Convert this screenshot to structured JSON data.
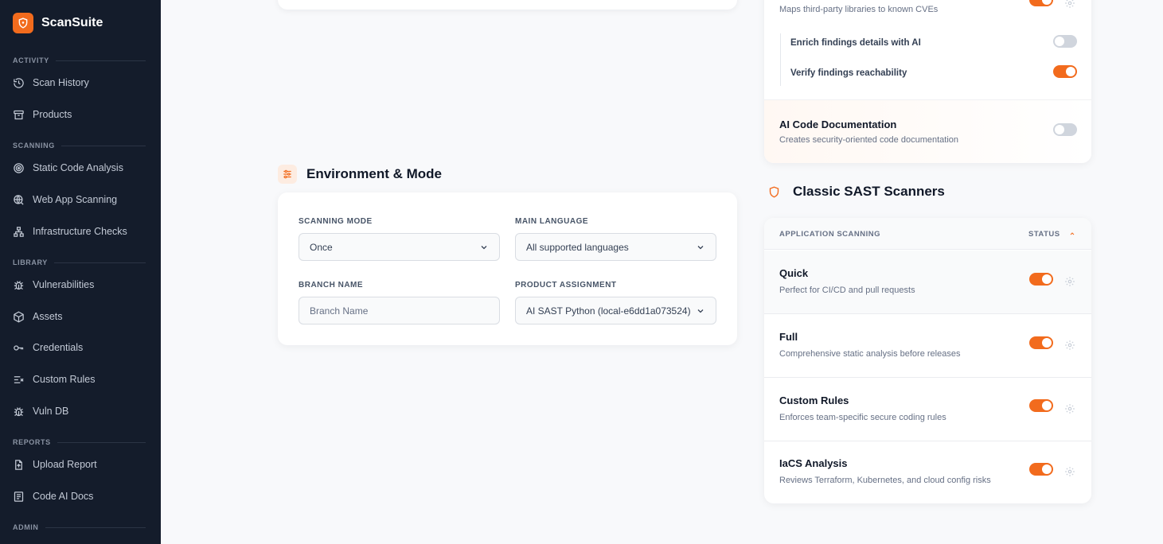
{
  "brand": {
    "name": "ScanSuite",
    "accent": "#f26b1d",
    "sidebar_bg": "#141c2b"
  },
  "sidebar": {
    "sections": [
      {
        "label": "ACTIVITY"
      },
      {
        "label": "SCANNING"
      },
      {
        "label": "LIBRARY"
      },
      {
        "label": "REPORTS"
      },
      {
        "label": "ADMIN"
      }
    ],
    "items": [
      {
        "label": "Scan History",
        "icon": "history-icon"
      },
      {
        "label": "Products",
        "icon": "archive-icon"
      },
      {
        "label": "Static Code Analysis",
        "icon": "target-icon"
      },
      {
        "label": "Web App Scanning",
        "icon": "globe-search-icon"
      },
      {
        "label": "Infrastructure Checks",
        "icon": "network-icon"
      },
      {
        "label": "Vulnerabilities",
        "icon": "bug-icon"
      },
      {
        "label": "Assets",
        "icon": "cube-icon"
      },
      {
        "label": "Credentials",
        "icon": "key-icon"
      },
      {
        "label": "Custom Rules",
        "icon": "list-x-icon"
      },
      {
        "label": "Vuln DB",
        "icon": "bug-icon"
      },
      {
        "label": "Upload Report",
        "icon": "file-upload-icon"
      },
      {
        "label": "Code AI Docs",
        "icon": "document-icon"
      }
    ]
  },
  "environment": {
    "title": "Environment & Mode",
    "scanning_mode": {
      "label": "SCANNING MODE",
      "value": "Once"
    },
    "main_language": {
      "label": "MAIN LANGUAGE",
      "value": "All supported languages"
    },
    "branch_name": {
      "label": "BRANCH NAME",
      "placeholder": "Branch Name"
    },
    "product_assignment": {
      "label": "PRODUCT ASSIGNMENT",
      "value": "AI SAST Python (local-e6dd1a073524)"
    }
  },
  "ai_features": {
    "sca_desc": "Maps third-party libraries to known CVEs",
    "sub_options": [
      {
        "label": "Enrich findings details with AI",
        "enabled": false
      },
      {
        "label": "Verify findings reachability",
        "enabled": true
      }
    ],
    "ai_code_doc": {
      "title": "AI Code Documentation",
      "desc": "Creates security-oriented code documentation",
      "enabled": false
    }
  },
  "classic": {
    "title": "Classic SAST Scanners",
    "col_app": "APPLICATION SCANNING",
    "col_status": "STATUS",
    "scanners": [
      {
        "name": "Quick",
        "desc": "Perfect for CI/CD and pull requests",
        "enabled": true
      },
      {
        "name": "Full",
        "desc": "Comprehensive static analysis before releases",
        "enabled": true
      },
      {
        "name": "Custom Rules",
        "desc": "Enforces team-specific secure coding rules",
        "enabled": true
      },
      {
        "name": "IaCS Analysis",
        "desc": "Reviews Terraform, Kubernetes, and cloud config risks",
        "enabled": true
      }
    ]
  }
}
